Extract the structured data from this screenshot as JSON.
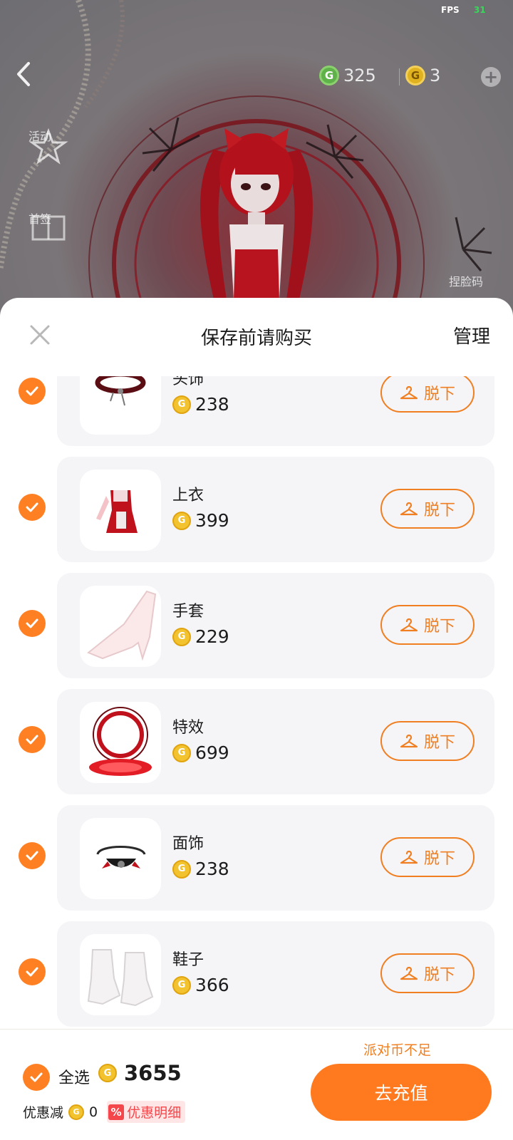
{
  "hud": {
    "fps_label": "FPS",
    "fps_value": "31"
  },
  "wallet": {
    "coins": "325",
    "diamonds": "3"
  },
  "side_entries": {
    "activity": "活动",
    "gift": "首签",
    "face_code": "捏脸码"
  },
  "sheet": {
    "title": "保存前请购买",
    "manage_label": "管理",
    "takeoff_label": "脱下"
  },
  "items": [
    {
      "name": "头饰",
      "price": "238",
      "icon": "choker-thumbnail"
    },
    {
      "name": "上衣",
      "price": "399",
      "icon": "maid-dress-thumbnail"
    },
    {
      "name": "手套",
      "price": "229",
      "icon": "glove-thumbnail"
    },
    {
      "name": "特效",
      "price": "699",
      "icon": "effect-thumbnail"
    },
    {
      "name": "面饰",
      "price": "238",
      "icon": "face-mask-thumbnail"
    },
    {
      "name": "鞋子",
      "price": "366",
      "icon": "shoes-thumbnail"
    }
  ],
  "footer": {
    "select_all": "全选",
    "total": "3655",
    "discount_label": "优惠减",
    "discount_value": "0",
    "discount_detail": "优惠明细",
    "percent_symbol": "%",
    "insufficient": "派对币不足",
    "recharge": "去充值"
  },
  "colors": {
    "accent": "#ff7f23",
    "coin": "#f2c22f",
    "warn_red": "#f3474b"
  }
}
